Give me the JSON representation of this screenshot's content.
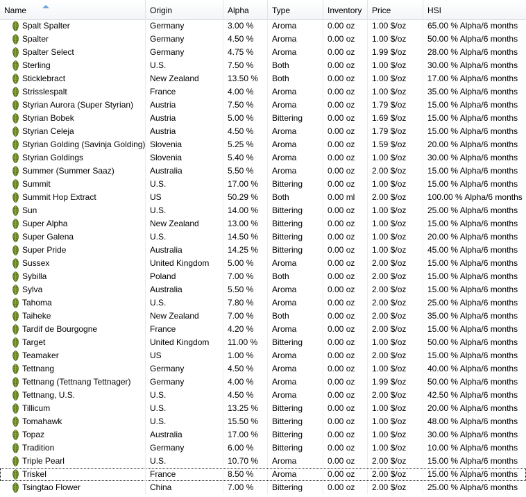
{
  "columns": {
    "name": "Name",
    "origin": "Origin",
    "alpha": "Alpha",
    "type": "Type",
    "inventory": "Inventory",
    "price": "Price",
    "hsi": "HSI"
  },
  "row_icon": "hop-icon",
  "rows": [
    {
      "name": "Spalt Spalter",
      "origin": "Germany",
      "alpha": "3.00 %",
      "type": "Aroma",
      "inventory": "0.00 oz",
      "price": "1.00 $/oz",
      "hsi": "65.00 % Alpha/6 months"
    },
    {
      "name": "Spalter",
      "origin": "Germany",
      "alpha": "4.50 %",
      "type": "Aroma",
      "inventory": "0.00 oz",
      "price": "1.00 $/oz",
      "hsi": "50.00 % Alpha/6 months"
    },
    {
      "name": "Spalter Select",
      "origin": "Germany",
      "alpha": "4.75 %",
      "type": "Aroma",
      "inventory": "0.00 oz",
      "price": "1.99 $/oz",
      "hsi": "28.00 % Alpha/6 months"
    },
    {
      "name": "Sterling",
      "origin": "U.S.",
      "alpha": "7.50 %",
      "type": "Both",
      "inventory": "0.00 oz",
      "price": "1.00 $/oz",
      "hsi": "30.00 % Alpha/6 months"
    },
    {
      "name": "Sticklebract",
      "origin": "New Zealand",
      "alpha": "13.50 %",
      "type": "Both",
      "inventory": "0.00 oz",
      "price": "1.00 $/oz",
      "hsi": "17.00 % Alpha/6 months"
    },
    {
      "name": "Strisslespalt",
      "origin": "France",
      "alpha": "4.00 %",
      "type": "Aroma",
      "inventory": "0.00 oz",
      "price": "1.00 $/oz",
      "hsi": "35.00 % Alpha/6 months"
    },
    {
      "name": "Styrian Aurora (Super Styrian)",
      "origin": "Austria",
      "alpha": "7.50 %",
      "type": "Aroma",
      "inventory": "0.00 oz",
      "price": "1.79 $/oz",
      "hsi": "15.00 % Alpha/6 months"
    },
    {
      "name": "Styrian Bobek",
      "origin": "Austria",
      "alpha": "5.00 %",
      "type": "Bittering",
      "inventory": "0.00 oz",
      "price": "1.69 $/oz",
      "hsi": "15.00 % Alpha/6 months"
    },
    {
      "name": "Styrian Celeja",
      "origin": "Austria",
      "alpha": "4.50 %",
      "type": "Aroma",
      "inventory": "0.00 oz",
      "price": "1.79 $/oz",
      "hsi": "15.00 % Alpha/6 months"
    },
    {
      "name": "Styrian Golding (Savinja Golding)",
      "origin": "Slovenia",
      "alpha": "5.25 %",
      "type": "Aroma",
      "inventory": "0.00 oz",
      "price": "1.59 $/oz",
      "hsi": "20.00 % Alpha/6 months"
    },
    {
      "name": "Styrian Goldings",
      "origin": "Slovenia",
      "alpha": "5.40 %",
      "type": "Aroma",
      "inventory": "0.00 oz",
      "price": "1.00 $/oz",
      "hsi": "30.00 % Alpha/6 months"
    },
    {
      "name": "Summer (Summer Saaz)",
      "origin": "Australia",
      "alpha": "5.50 %",
      "type": "Aroma",
      "inventory": "0.00 oz",
      "price": "2.00 $/oz",
      "hsi": "15.00 % Alpha/6 months"
    },
    {
      "name": "Summit",
      "origin": "U.S.",
      "alpha": "17.00 %",
      "type": "Bittering",
      "inventory": "0.00 oz",
      "price": "1.00 $/oz",
      "hsi": "15.00 % Alpha/6 months"
    },
    {
      "name": "Summit Hop Extract",
      "origin": "US",
      "alpha": "50.29 %",
      "type": "Both",
      "inventory": "0.00 ml",
      "price": "2.00 $/oz",
      "hsi": "100.00 % Alpha/6 months"
    },
    {
      "name": "Sun",
      "origin": "U.S.",
      "alpha": "14.00 %",
      "type": "Bittering",
      "inventory": "0.00 oz",
      "price": "1.00 $/oz",
      "hsi": "25.00 % Alpha/6 months"
    },
    {
      "name": "Super Alpha",
      "origin": "New Zealand",
      "alpha": "13.00 %",
      "type": "Bittering",
      "inventory": "0.00 oz",
      "price": "1.00 $/oz",
      "hsi": "15.00 % Alpha/6 months"
    },
    {
      "name": "Super Galena",
      "origin": "U.S.",
      "alpha": "14.50 %",
      "type": "Bittering",
      "inventory": "0.00 oz",
      "price": "1.00 $/oz",
      "hsi": "20.00 % Alpha/6 months"
    },
    {
      "name": "Super Pride",
      "origin": "Australia",
      "alpha": "14.25 %",
      "type": "Bittering",
      "inventory": "0.00 oz",
      "price": "1.00 $/oz",
      "hsi": "45.00 % Alpha/6 months"
    },
    {
      "name": "Sussex",
      "origin": "United Kingdom",
      "alpha": "5.00 %",
      "type": "Aroma",
      "inventory": "0.00 oz",
      "price": "2.00 $/oz",
      "hsi": "15.00 % Alpha/6 months"
    },
    {
      "name": "Sybilla",
      "origin": "Poland",
      "alpha": "7.00 %",
      "type": "Both",
      "inventory": "0.00 oz",
      "price": "2.00 $/oz",
      "hsi": "15.00 % Alpha/6 months"
    },
    {
      "name": "Sylva",
      "origin": "Australia",
      "alpha": "5.50 %",
      "type": "Aroma",
      "inventory": "0.00 oz",
      "price": "2.00 $/oz",
      "hsi": "15.00 % Alpha/6 months"
    },
    {
      "name": "Tahoma",
      "origin": "U.S.",
      "alpha": "7.80 %",
      "type": "Aroma",
      "inventory": "0.00 oz",
      "price": "2.00 $/oz",
      "hsi": "25.00 % Alpha/6 months"
    },
    {
      "name": "Taiheke",
      "origin": "New Zealand",
      "alpha": "7.00 %",
      "type": "Both",
      "inventory": "0.00 oz",
      "price": "2.00 $/oz",
      "hsi": "35.00 % Alpha/6 months"
    },
    {
      "name": "Tardif de Bourgogne",
      "origin": "France",
      "alpha": "4.20 %",
      "type": "Aroma",
      "inventory": "0.00 oz",
      "price": "2.00 $/oz",
      "hsi": "15.00 % Alpha/6 months"
    },
    {
      "name": "Target",
      "origin": "United Kingdom",
      "alpha": "11.00 %",
      "type": "Bittering",
      "inventory": "0.00 oz",
      "price": "1.00 $/oz",
      "hsi": "50.00 % Alpha/6 months"
    },
    {
      "name": "Teamaker",
      "origin": "US",
      "alpha": "1.00 %",
      "type": "Aroma",
      "inventory": "0.00 oz",
      "price": "2.00 $/oz",
      "hsi": "15.00 % Alpha/6 months"
    },
    {
      "name": "Tettnang",
      "origin": "Germany",
      "alpha": "4.50 %",
      "type": "Aroma",
      "inventory": "0.00 oz",
      "price": "1.00 $/oz",
      "hsi": "40.00 % Alpha/6 months"
    },
    {
      "name": "Tettnang (Tettnang Tettnager)",
      "origin": "Germany",
      "alpha": "4.00 %",
      "type": "Aroma",
      "inventory": "0.00 oz",
      "price": "1.99 $/oz",
      "hsi": "50.00 % Alpha/6 months"
    },
    {
      "name": "Tettnang, U.S.",
      "origin": "U.S.",
      "alpha": "4.50 %",
      "type": "Aroma",
      "inventory": "0.00 oz",
      "price": "2.00 $/oz",
      "hsi": "42.50 % Alpha/6 months"
    },
    {
      "name": "Tillicum",
      "origin": "U.S.",
      "alpha": "13.25 %",
      "type": "Bittering",
      "inventory": "0.00 oz",
      "price": "1.00 $/oz",
      "hsi": "20.00 % Alpha/6 months"
    },
    {
      "name": "Tomahawk",
      "origin": "U.S.",
      "alpha": "15.50 %",
      "type": "Bittering",
      "inventory": "0.00 oz",
      "price": "1.00 $/oz",
      "hsi": "48.00 % Alpha/6 months"
    },
    {
      "name": "Topaz",
      "origin": "Australia",
      "alpha": "17.00 %",
      "type": "Bittering",
      "inventory": "0.00 oz",
      "price": "1.00 $/oz",
      "hsi": "30.00 % Alpha/6 months"
    },
    {
      "name": "Tradition",
      "origin": "Germany",
      "alpha": "6.00 %",
      "type": "Bittering",
      "inventory": "0.00 oz",
      "price": "1.00 $/oz",
      "hsi": "10.00 % Alpha/6 months"
    },
    {
      "name": "Triple Pearl",
      "origin": "U.S.",
      "alpha": "10.70 %",
      "type": "Aroma",
      "inventory": "0.00 oz",
      "price": "2.00 $/oz",
      "hsi": "15.00 % Alpha/6 months"
    },
    {
      "name": "Triskel",
      "origin": "France",
      "alpha": "8.50 %",
      "type": "Aroma",
      "inventory": "0.00 oz",
      "price": "2.00 $/oz",
      "hsi": "15.00 % Alpha/6 months",
      "selected": true
    },
    {
      "name": "Tsingtao Flower",
      "origin": "China",
      "alpha": "7.00 %",
      "type": "Bittering",
      "inventory": "0.00 oz",
      "price": "2.00 $/oz",
      "hsi": "25.00 % Alpha/6 months"
    }
  ]
}
